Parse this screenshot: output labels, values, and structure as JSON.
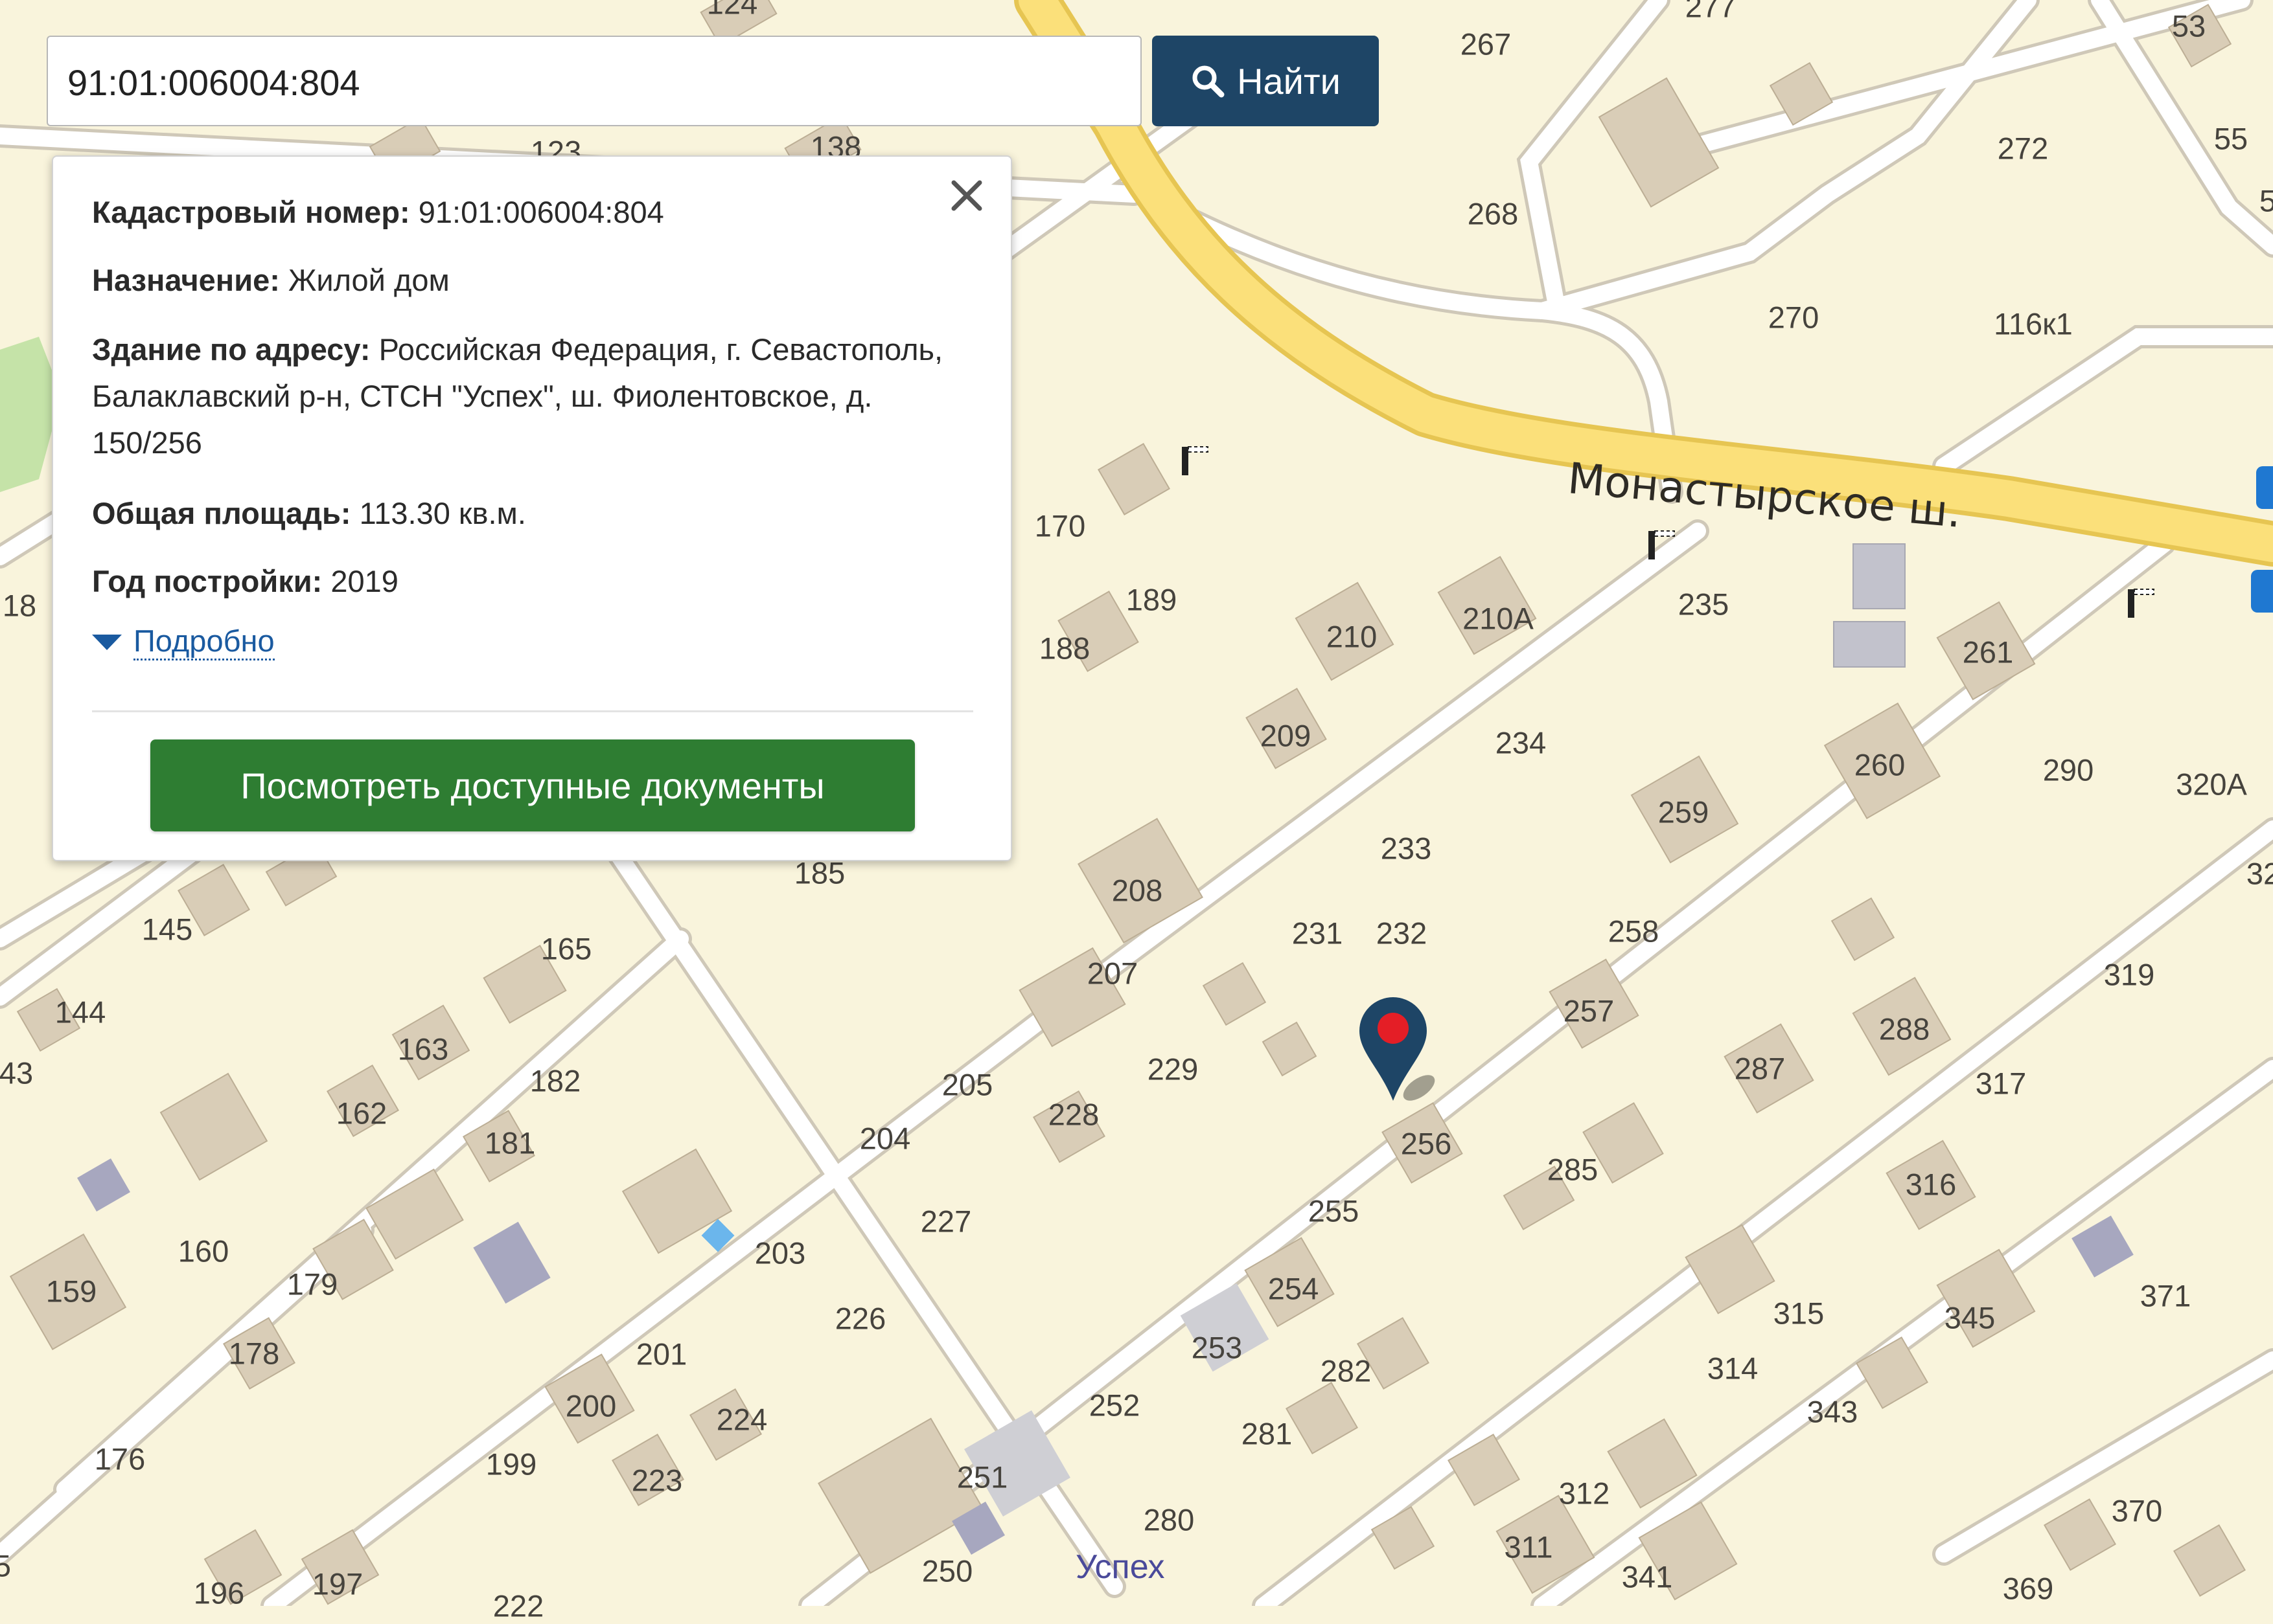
{
  "search": {
    "value": "91:01:006004:804",
    "placeholder": "",
    "button_label": "Найти"
  },
  "card": {
    "rows": [
      {
        "label": "Кадастровый номер:",
        "value": "91:01:006004:804"
      },
      {
        "label": "Назначение:",
        "value": "Жилой дом"
      },
      {
        "label": "Здание по адресу:",
        "value": "Российская Федерация, г. Севастополь, Балаклавский р-н, СТСН \"Успех\", ш. Фиолентовское, д. 150/256"
      },
      {
        "label": "Общая площадь:",
        "value": "113.30 кв.м."
      },
      {
        "label": "Год постройки:",
        "value": "2019"
      }
    ],
    "details_link": "Подробно",
    "docs_button": "Посмотреть доступные документы"
  },
  "map": {
    "street_name": "Монастырское ш.",
    "district_name": "Успех",
    "house_numbers": [
      "124",
      "277",
      "53",
      "267",
      "55",
      "123",
      "138",
      "272",
      "268",
      "5",
      "270",
      "116к1",
      "18",
      "170",
      "189",
      "235",
      "210",
      "210А",
      "261",
      "188",
      "209",
      "234",
      "260",
      "290",
      "320А",
      "259",
      "233",
      "185",
      "208",
      "32",
      "145",
      "231",
      "232",
      "258",
      "165",
      "319",
      "144",
      "207",
      "257",
      "163",
      "288",
      "43",
      "182",
      "229",
      "287",
      "317",
      "205",
      "228",
      "162",
      "181",
      "204",
      "256",
      "285",
      "227",
      "316",
      "255",
      "160",
      "203",
      "159",
      "179",
      "371",
      "254",
      "226",
      "345",
      "178",
      "201",
      "253",
      "282",
      "315",
      "200",
      "252",
      "314",
      "224",
      "343",
      "176",
      "281",
      "199",
      "251",
      "312",
      "223",
      "280",
      "311",
      "370",
      "5",
      "250",
      "341",
      "196",
      "197",
      "369",
      "222"
    ],
    "colors": {
      "background": "#f9f4dc",
      "road_major": "#fbe07a",
      "building": "#d9cdb7",
      "pin": "#1e4566",
      "pin_dot": "#e41e26"
    }
  }
}
